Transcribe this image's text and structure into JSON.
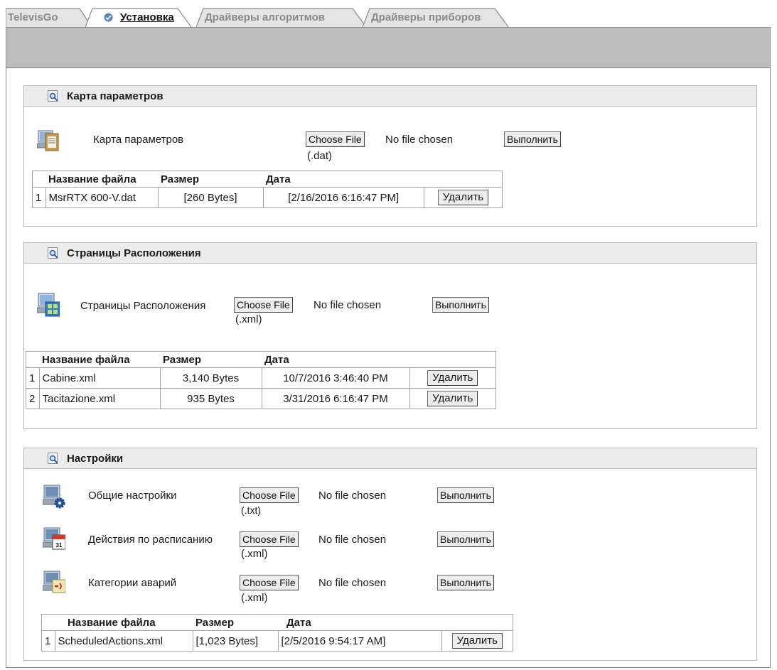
{
  "tabs": [
    {
      "label": "TelevisGo",
      "active": false
    },
    {
      "label": "Установка",
      "active": true
    },
    {
      "label": "Драйверы алгоритмов",
      "active": false
    },
    {
      "label": "Драйверы приборов",
      "active": false
    }
  ],
  "common": {
    "choose_file": "Choose File",
    "no_file": "No file chosen",
    "execute": "Выполнить",
    "delete": "Удалить",
    "col_name": "Название файла",
    "col_size": "Размер",
    "col_date": "Дата"
  },
  "param_map": {
    "title": "Карта параметров",
    "row_label": "Карта параметров",
    "ext": "(.dat)",
    "files": [
      {
        "n": "1",
        "name": "MsrRTX 600-V.dat",
        "size": "[260 Bytes]",
        "date": "[2/16/2016 6:16:47 PM]"
      }
    ]
  },
  "layout_pages": {
    "title": "Страницы Расположения",
    "row_label": "Страницы Расположения",
    "ext": "(.xml)",
    "files": [
      {
        "n": "1",
        "name": "Cabine.xml",
        "size": "3,140 Bytes",
        "date": "10/7/2016 3:46:40 PM"
      },
      {
        "n": "2",
        "name": "Tacitazione.xml",
        "size": "935 Bytes",
        "date": "3/31/2016 6:16:47 PM"
      }
    ]
  },
  "settings": {
    "title": "Настройки",
    "rows": [
      {
        "label": "Общие настройки",
        "ext": "(.txt)"
      },
      {
        "label": "Действия по расписанию",
        "ext": "(.xml)"
      },
      {
        "label": "Категории аварий",
        "ext": "(.xml)"
      }
    ],
    "files": [
      {
        "n": "1",
        "name": "ScheduledActions.xml",
        "size": "[1,023 Bytes]",
        "date": "[2/5/2016 9:54:17 AM]"
      }
    ]
  }
}
